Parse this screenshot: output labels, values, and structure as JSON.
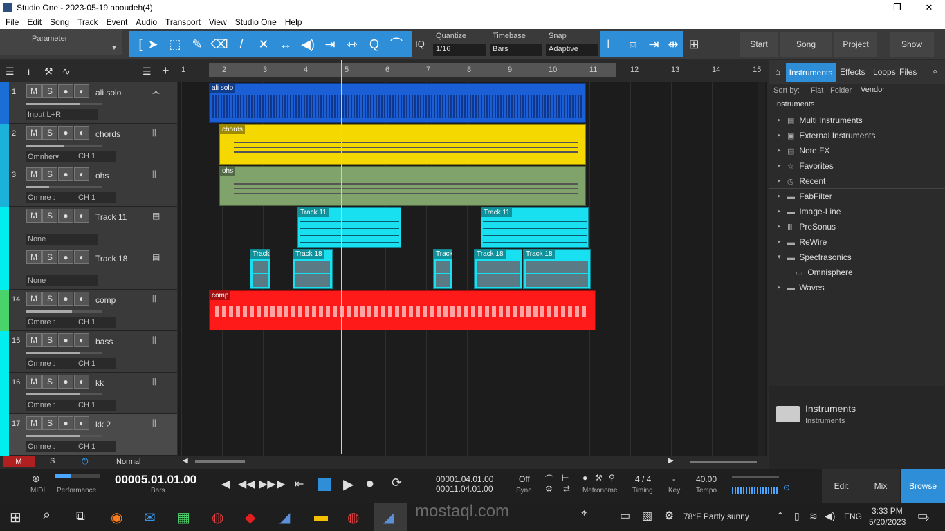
{
  "window": {
    "title": "Studio One - 2023-05-19 aboudeh(4)",
    "minimize": "—",
    "maximize": "❐",
    "close": "✕"
  },
  "menu": [
    "File",
    "Edit",
    "Song",
    "Track",
    "Event",
    "Audio",
    "Transport",
    "View",
    "Studio One",
    "Help"
  ],
  "toolbar": {
    "parameter": "Parameter",
    "quantize_label": "Quantize",
    "quantize": "1/16",
    "timebase_label": "Timebase",
    "timebase": "Bars",
    "snap_label": "Snap",
    "snap": "Adaptive",
    "iq": "IQ",
    "nav": [
      "Start",
      "Song",
      "Project",
      "Show"
    ]
  },
  "tracks": [
    {
      "num": "1",
      "name": "ali solo",
      "input": "Input L+R",
      "ch": "",
      "type": "audio",
      "color": "#1a6fd6",
      "vol": 0.7
    },
    {
      "num": "2",
      "name": "chords",
      "input": "Omnher▾",
      "ch": "CH 1",
      "type": "instrument",
      "color": "#1ab2d8",
      "vol": 0.5
    },
    {
      "num": "3",
      "name": "ohs",
      "input": "Omnre :",
      "ch": "CH 1",
      "type": "instrument",
      "color": "#1ab2d8",
      "vol": 0.3
    },
    {
      "num": "",
      "name": "Track 11",
      "input": "None",
      "ch": "",
      "type": "folder",
      "color": "#0ee",
      "vol": 0
    },
    {
      "num": "",
      "name": "Track 18",
      "input": "None",
      "ch": "",
      "type": "folder",
      "color": "#0ee",
      "vol": 0
    },
    {
      "num": "14",
      "name": "comp",
      "input": "Omnre :",
      "ch": "CH 1",
      "type": "instrument",
      "color": "#4bd36b",
      "vol": 0.6
    },
    {
      "num": "15",
      "name": "bass",
      "input": "Omnre :",
      "ch": "CH 1",
      "type": "instrument",
      "color": "#0ee",
      "vol": 0.7
    },
    {
      "num": "16",
      "name": "kk",
      "input": "Omnre :",
      "ch": "CH 1",
      "type": "instrument",
      "color": "#0ee",
      "vol": 0.7
    },
    {
      "num": "17",
      "name": "kk 2",
      "input": "Omnre :",
      "ch": "CH 1",
      "type": "instrument",
      "color": "#0ee",
      "vol": 0.7
    }
  ],
  "track_buttons": {
    "m": "M",
    "s": "S",
    "rec": "●",
    "mon": "◐"
  },
  "ruler": [
    "1",
    "2",
    "3",
    "4",
    "5",
    "6",
    "7",
    "8",
    "9",
    "10",
    "11",
    "12",
    "13",
    "14",
    "15"
  ],
  "clips": [
    {
      "label": "ali solo",
      "color": "#1a5fd6"
    },
    {
      "label": "chords",
      "color": "#f5d800"
    },
    {
      "label": "ohs",
      "color": "#7fa36a"
    },
    {
      "label": "Track 11",
      "color": "#19e0f0"
    },
    {
      "label": "Track 11",
      "color": "#19e0f0"
    },
    {
      "label": "Track",
      "color": "#19e0f0"
    },
    {
      "label": "Track 18",
      "color": "#19e0f0"
    },
    {
      "label": "Track",
      "color": "#19e0f0"
    },
    {
      "label": "Track 18",
      "color": "#19e0f0"
    },
    {
      "label": "Track 18",
      "color": "#19e0f0"
    },
    {
      "label": "comp",
      "color": "#ff1a1a"
    }
  ],
  "arr_bottom": {
    "m": "M",
    "s": "S",
    "mode": "Normal"
  },
  "browser": {
    "tabs": [
      "Instruments",
      "Effects",
      "Loops",
      "Files"
    ],
    "sortby": "Sort by:",
    "flat": "Flat",
    "folder": "Folder",
    "vendor": "Vendor",
    "path": "Instruments",
    "items": [
      "Multi Instruments",
      "External Instruments",
      "Note FX",
      "Favorites",
      "Recent",
      "FabFilter",
      "Image-Line",
      "PreSonus",
      "ReWire",
      "Spectrasonics",
      "Omnisphere",
      "Waves"
    ],
    "footer_title": "Instruments",
    "footer_sub": "Instruments"
  },
  "transport": {
    "midi": "MIDI",
    "performance": "Performance",
    "time": "00005.01.01.00",
    "time_unit": "Bars",
    "loop_start": "00001.04.01.00",
    "loop_end": "00011.04.01.00",
    "sync_state": "Off",
    "sync": "Sync",
    "metronome": "Metronome",
    "timing_val": "4 / 4",
    "timing": "Timing",
    "key_val": "-",
    "key": "Key",
    "tempo_val": "40.00",
    "tempo": "Tempo",
    "views": [
      "Edit",
      "Mix",
      "Browse"
    ]
  },
  "taskbar": {
    "weather": "78°F  Partly sunny",
    "lang": "ENG",
    "time": "3:33 PM",
    "date": "5/20/2023",
    "notif": "2",
    "watermark": "mostaql.com"
  }
}
